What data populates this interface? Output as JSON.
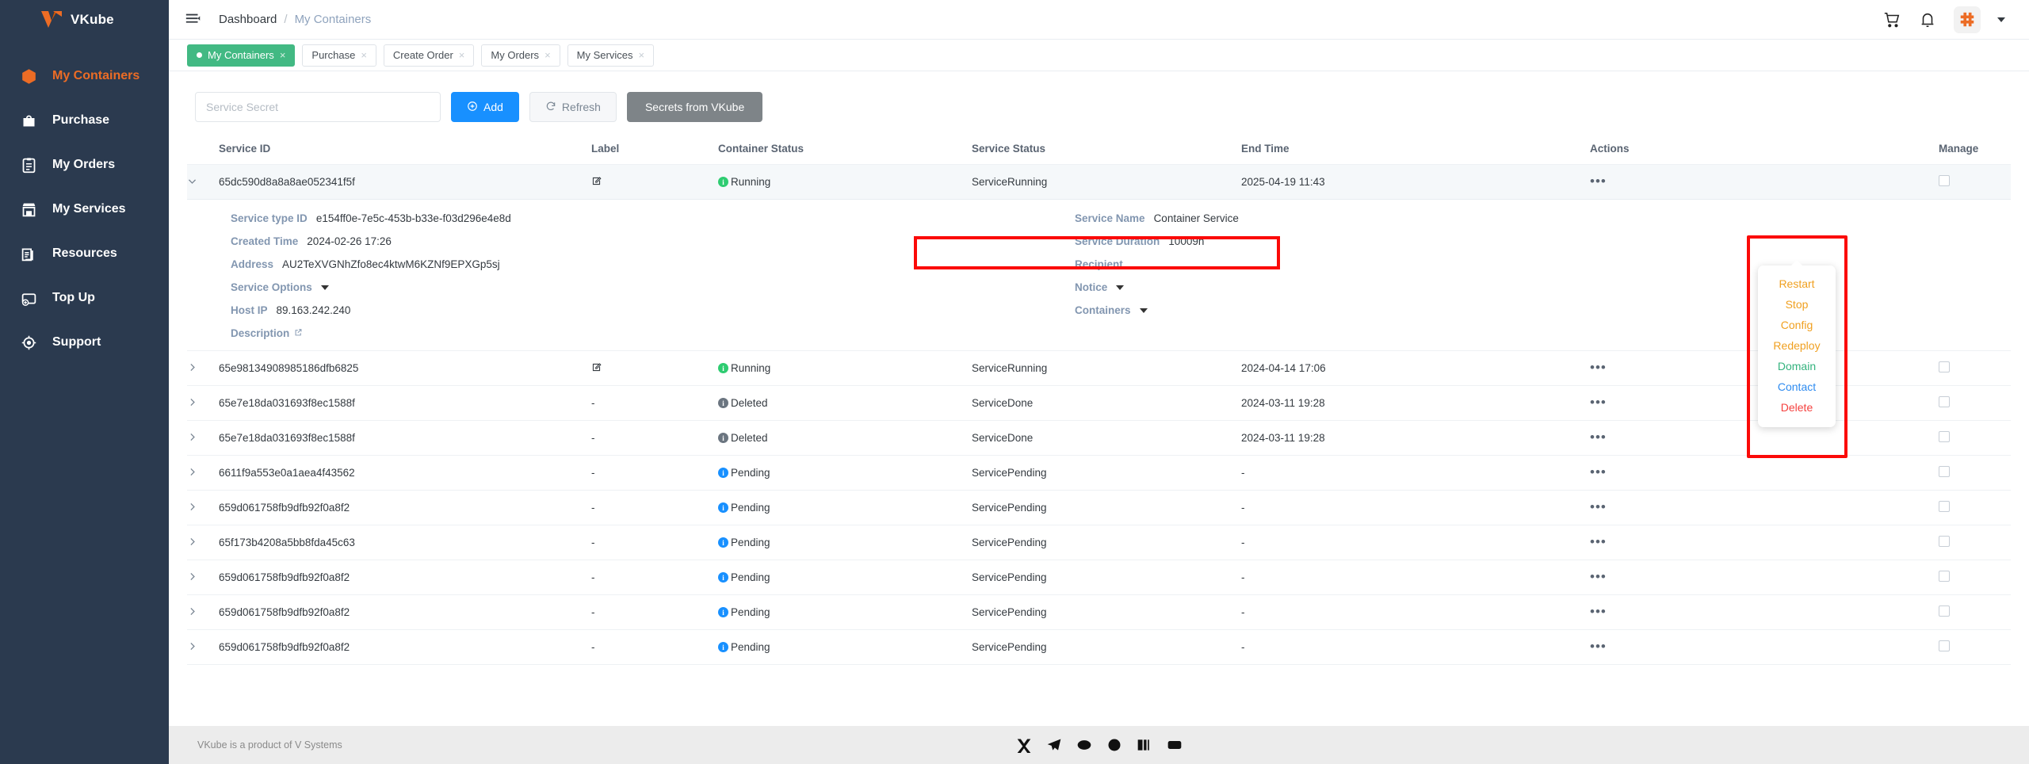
{
  "brand": {
    "name": "VKube",
    "logo_icon": "v-logo-icon"
  },
  "sidebar": {
    "items": [
      {
        "label": "My Containers",
        "icon": "box-icon",
        "active": true
      },
      {
        "label": "Purchase",
        "icon": "bag-icon",
        "active": false
      },
      {
        "label": "My Orders",
        "icon": "clipboard-icon",
        "active": false
      },
      {
        "label": "My Services",
        "icon": "store-icon",
        "active": false
      },
      {
        "label": "Resources",
        "icon": "documents-icon",
        "active": false
      },
      {
        "label": "Top Up",
        "icon": "wallet-plus-icon",
        "active": false
      },
      {
        "label": "Support",
        "icon": "headset-icon",
        "active": false
      }
    ]
  },
  "topbar": {
    "menu_icon": "hamburger-icon",
    "breadcrumb": {
      "home": "Dashboard",
      "separator": "/",
      "current": "My Containers"
    },
    "cart_icon": "cart-icon",
    "bell_icon": "bell-icon",
    "avatar_icon": "user-avatar-icon",
    "caret_icon": "chevron-down-icon"
  },
  "tabs": [
    {
      "label": "My Containers",
      "active": true,
      "close": "×"
    },
    {
      "label": "Purchase",
      "active": false,
      "close": "×"
    },
    {
      "label": "Create Order",
      "active": false,
      "close": "×"
    },
    {
      "label": "My Orders",
      "active": false,
      "close": "×"
    },
    {
      "label": "My Services",
      "active": false,
      "close": "×"
    }
  ],
  "toolbar": {
    "secret_placeholder": "Service Secret",
    "secret_value": "",
    "add_label": "Add",
    "add_icon": "plus-circle-icon",
    "refresh_label": "Refresh",
    "refresh_icon": "refresh-icon",
    "secrets_label": "Secrets from VKube"
  },
  "table": {
    "headers": {
      "service_id": "Service ID",
      "label": "Label",
      "container_status": "Container Status",
      "service_status": "Service Status",
      "end_time": "End Time",
      "actions": "Actions",
      "manage": "Manage"
    },
    "rows": [
      {
        "service_id": "65dc590d8a8a8ae052341f5f",
        "label": "edit-icon",
        "container_status": "Running",
        "status_kind": "running",
        "service_status": "ServiceRunning",
        "end_time": "2025-04-19 11:43",
        "expanded": true
      },
      {
        "service_id": "65e98134908985186dfb6825",
        "label": "edit-icon",
        "container_status": "Running",
        "status_kind": "running",
        "service_status": "ServiceRunning",
        "end_time": "2024-04-14 17:06",
        "expanded": false
      },
      {
        "service_id": "65e7e18da031693f8ec1588f",
        "label": "-",
        "container_status": "Deleted",
        "status_kind": "deleted",
        "service_status": "ServiceDone",
        "end_time": "2024-03-11 19:28",
        "expanded": false
      },
      {
        "service_id": "65e7e18da031693f8ec1588f",
        "label": "-",
        "container_status": "Deleted",
        "status_kind": "deleted",
        "service_status": "ServiceDone",
        "end_time": "2024-03-11 19:28",
        "expanded": false
      },
      {
        "service_id": "6611f9a553e0a1aea4f43562",
        "label": "-",
        "container_status": "Pending",
        "status_kind": "pending",
        "service_status": "ServicePending",
        "end_time": "-",
        "expanded": false
      },
      {
        "service_id": "659d061758fb9dfb92f0a8f2",
        "label": "-",
        "container_status": "Pending",
        "status_kind": "pending",
        "service_status": "ServicePending",
        "end_time": "-",
        "expanded": false
      },
      {
        "service_id": "65f173b4208a5bb8fda45c63",
        "label": "-",
        "container_status": "Pending",
        "status_kind": "pending",
        "service_status": "ServicePending",
        "end_time": "-",
        "expanded": false
      },
      {
        "service_id": "659d061758fb9dfb92f0a8f2",
        "label": "-",
        "container_status": "Pending",
        "status_kind": "pending",
        "service_status": "ServicePending",
        "end_time": "-",
        "expanded": false
      },
      {
        "service_id": "659d061758fb9dfb92f0a8f2",
        "label": "-",
        "container_status": "Pending",
        "status_kind": "pending",
        "service_status": "ServicePending",
        "end_time": "-",
        "expanded": false
      },
      {
        "service_id": "659d061758fb9dfb92f0a8f2",
        "label": "-",
        "container_status": "Pending",
        "status_kind": "pending",
        "service_status": "ServicePending",
        "end_time": "-",
        "expanded": false
      }
    ]
  },
  "detail": {
    "left": {
      "service_type_id_label": "Service type ID",
      "service_type_id_value": "e154ff0e-7e5c-453b-b33e-f03d296e4e8d",
      "created_time_label": "Created Time",
      "created_time_value": "2024-02-26 17:26",
      "address_label": "Address",
      "address_value": "AU2TeXVGNhZfo8ec4ktwM6KZNf9EPXGp5sj",
      "service_options_label": "Service Options",
      "host_ip_label": "Host IP",
      "host_ip_value": "89.163.242.240",
      "description_label": "Description",
      "description_icon": "external-link-icon"
    },
    "right": {
      "service_name_label": "Service Name",
      "service_name_value": "Container Service",
      "service_duration_label": "Service Duration",
      "service_duration_value": "10009h",
      "recipient_label": "Recipient",
      "recipient_value": "",
      "notice_label": "Notice",
      "containers_label": "Containers"
    }
  },
  "action_menu": {
    "items": [
      {
        "label": "Restart",
        "color": "orange"
      },
      {
        "label": "Stop",
        "color": "orange"
      },
      {
        "label": "Config",
        "color": "orange"
      },
      {
        "label": "Redeploy",
        "color": "orange"
      },
      {
        "label": "Domain",
        "color": "green"
      },
      {
        "label": "Contact",
        "color": "blue"
      },
      {
        "label": "Delete",
        "color": "red"
      }
    ],
    "trigger_icon": "ellipsis-icon"
  },
  "footer": {
    "text": "VKube is a product of V Systems",
    "social_icons": [
      "twitter-icon",
      "telegram-icon",
      "discord-icon",
      "reddit-icon",
      "medium-icon",
      "youtube-icon"
    ]
  },
  "colors": {
    "brand_orange": "#ec6c25",
    "sidebar_bg": "#2b3a4f",
    "accent_blue": "#1890ff",
    "tab_green": "#42b983",
    "status_running": "#2ecc71",
    "status_deleted": "#6b7580",
    "status_pending": "#1890ff",
    "highlight_red": "#fb0a08"
  }
}
